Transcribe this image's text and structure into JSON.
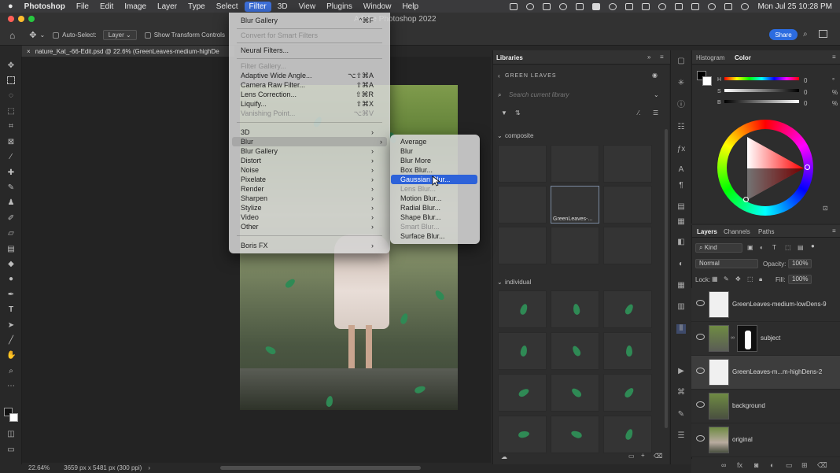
{
  "menubar": {
    "app": "Photoshop",
    "items": [
      "File",
      "Edit",
      "Image",
      "Layer",
      "Type",
      "Select",
      "Filter",
      "3D",
      "View",
      "Plugins",
      "Window",
      "Help"
    ],
    "active": "Filter",
    "clock": "Mon Jul 25  10:28 PM"
  },
  "window": {
    "title": "Adobe Photoshop 2022"
  },
  "options": {
    "auto_select_label": "Auto-Select:",
    "layer_value": "Layer",
    "transform_label": "Show Transform Controls",
    "share_label": "Share"
  },
  "document": {
    "tab_title": "nature_Kat_-66-Edit.psd @ 22.6% (GreenLeaves-medium-highDe",
    "zoom": "22.64%",
    "dims": "3659 px x 5481 px (300 ppi)"
  },
  "filter_menu": {
    "items": [
      {
        "label": "Blur Gallery",
        "shortcut": "^⌘F",
        "state": "normal"
      },
      {
        "label": "Convert for Smart Filters",
        "shortcut": "",
        "state": "disabled"
      },
      {
        "label": "Neural Filters...",
        "shortcut": "",
        "state": "normal"
      },
      {
        "label": "Filter Gallery...",
        "shortcut": "",
        "state": "disabled"
      },
      {
        "label": "Adaptive Wide Angle...",
        "shortcut": "⌥⇧⌘A",
        "state": "normal"
      },
      {
        "label": "Camera Raw Filter...",
        "shortcut": "⇧⌘A",
        "state": "normal"
      },
      {
        "label": "Lens Correction...",
        "shortcut": "⇧⌘R",
        "state": "normal"
      },
      {
        "label": "Liquify...",
        "shortcut": "⇧⌘X",
        "state": "normal"
      },
      {
        "label": "Vanishing Point...",
        "shortcut": "⌥⌘V",
        "state": "disabled"
      },
      {
        "label": "3D",
        "shortcut": "›",
        "state": "normal"
      },
      {
        "label": "Blur",
        "shortcut": "›",
        "state": "highlighted"
      },
      {
        "label": "Blur Gallery",
        "shortcut": "›",
        "state": "normal"
      },
      {
        "label": "Distort",
        "shortcut": "›",
        "state": "normal"
      },
      {
        "label": "Noise",
        "shortcut": "›",
        "state": "normal"
      },
      {
        "label": "Pixelate",
        "shortcut": "›",
        "state": "normal"
      },
      {
        "label": "Render",
        "shortcut": "›",
        "state": "normal"
      },
      {
        "label": "Sharpen",
        "shortcut": "›",
        "state": "normal"
      },
      {
        "label": "Stylize",
        "shortcut": "›",
        "state": "normal"
      },
      {
        "label": "Video",
        "shortcut": "›",
        "state": "normal"
      },
      {
        "label": "Other",
        "shortcut": "›",
        "state": "normal"
      },
      {
        "label": "Boris FX",
        "shortcut": "›",
        "state": "normal"
      }
    ]
  },
  "blur_menu": {
    "items": [
      {
        "label": "Average",
        "state": "normal"
      },
      {
        "label": "Blur",
        "state": "normal"
      },
      {
        "label": "Blur More",
        "state": "normal"
      },
      {
        "label": "Box Blur...",
        "state": "normal"
      },
      {
        "label": "Gaussian Blur...",
        "state": "selected"
      },
      {
        "label": "Lens Blur...",
        "state": "disabled"
      },
      {
        "label": "Motion Blur...",
        "state": "normal"
      },
      {
        "label": "Radial Blur...",
        "state": "normal"
      },
      {
        "label": "Shape Blur...",
        "state": "normal"
      },
      {
        "label": "Smart Blur...",
        "state": "disabled"
      },
      {
        "label": "Surface Blur...",
        "state": "normal"
      }
    ]
  },
  "libraries": {
    "title": "Libraries",
    "library_name": "GREEN LEAVES",
    "search_placeholder": "Search current library",
    "section_composite": "composite",
    "section_individual": "individual",
    "selected_thumb_label": "GreenLeaves-..."
  },
  "color_panel": {
    "tabs": [
      "Histogram",
      "Color"
    ],
    "active_tab": "Color",
    "h": "0",
    "s": "0",
    "b": "0",
    "pct": "%",
    "deg": "°"
  },
  "layers_panel": {
    "tabs": [
      "Layers",
      "Channels",
      "Paths"
    ],
    "active_tab": "Layers",
    "filter_kind": "Kind",
    "blend_mode": "Normal",
    "opacity_label": "Opacity:",
    "opacity_value": "100%",
    "lock_label": "Lock:",
    "fill_label": "Fill:",
    "fill_value": "100%",
    "layers": [
      {
        "name": "GreenLeaves-medium-lowDens-9",
        "selected": false
      },
      {
        "name": "subject",
        "selected": false
      },
      {
        "name": "GreenLeaves-m...m-highDens-2",
        "selected": true
      },
      {
        "name": "background",
        "selected": false
      },
      {
        "name": "original",
        "selected": false
      }
    ]
  },
  "colors": {
    "accent": "#2d62d9",
    "panel": "#2d2d2d",
    "menu_bg": "#d6d6d6"
  }
}
